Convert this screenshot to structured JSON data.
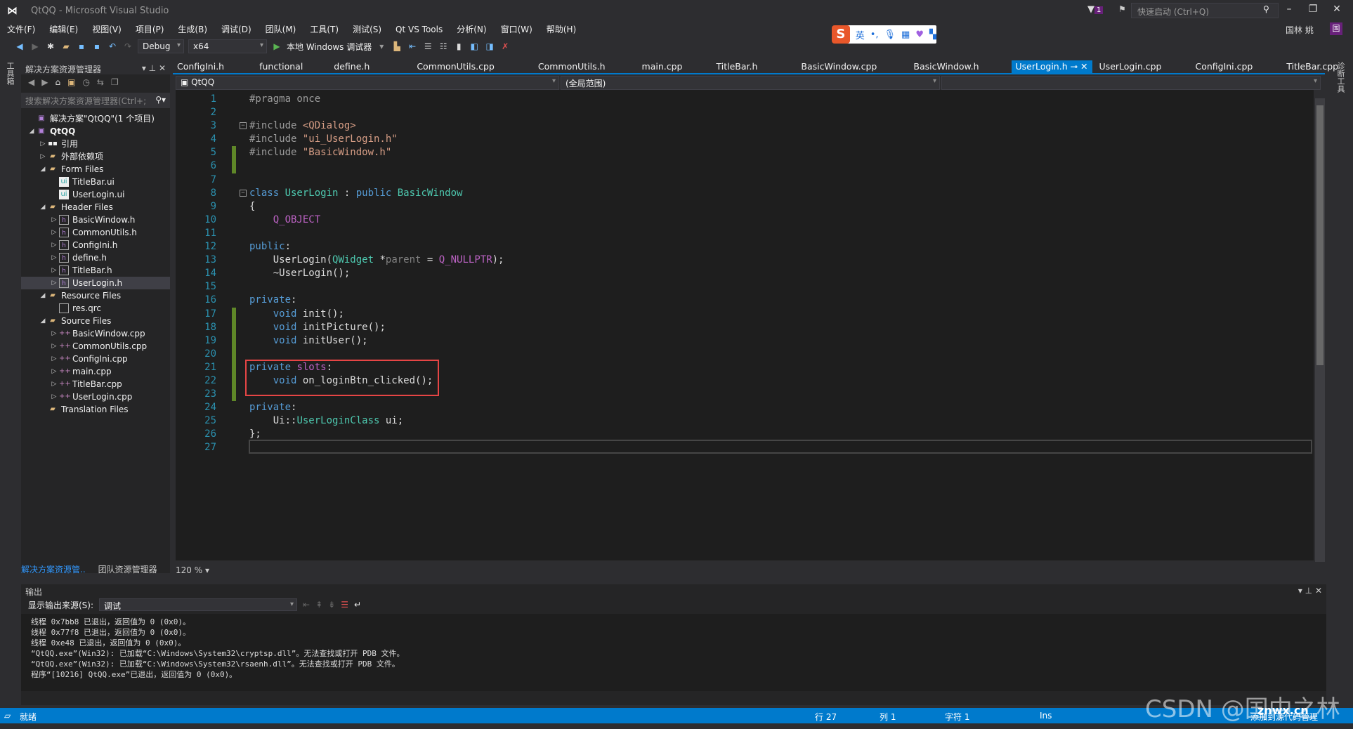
{
  "window": {
    "title": "QtQQ - Microsoft Visual Studio",
    "quick_launch_placeholder": "快速启动 (Ctrl+Q)",
    "notification_count": "1",
    "user": "国林 姚",
    "user_badge": "国"
  },
  "menu": [
    "文件(F)",
    "编辑(E)",
    "视图(V)",
    "项目(P)",
    "生成(B)",
    "调试(D)",
    "团队(M)",
    "工具(T)",
    "测试(S)",
    "Qt VS Tools",
    "分析(N)",
    "窗口(W)",
    "帮助(H)"
  ],
  "toolbar": {
    "config": "Debug",
    "platform": "x64",
    "run_label": "本地 Windows 调试器"
  },
  "ime": {
    "lang": "英"
  },
  "left_strip": "工具箱",
  "right_strip": "诊断工具",
  "solution_explorer": {
    "title": "解决方案资源管理器",
    "search_placeholder": "搜索解决方案资源管理器(Ctrl+;",
    "tree": [
      {
        "label": "解决方案\"QtQQ\"(1 个项目)",
        "level": 0,
        "arrow": "",
        "icon": "proj"
      },
      {
        "label": "QtQQ",
        "level": 0,
        "arrow": "◢",
        "icon": "proj"
      },
      {
        "label": "引用",
        "level": 1,
        "arrow": "▷",
        "icon": "ref"
      },
      {
        "label": "外部依赖项",
        "level": 1,
        "arrow": "▷",
        "icon": "folder"
      },
      {
        "label": "Form Files",
        "level": 1,
        "arrow": "◢",
        "icon": "folder"
      },
      {
        "label": "TitleBar.ui",
        "level": 2,
        "arrow": "",
        "icon": "ui"
      },
      {
        "label": "UserLogin.ui",
        "level": 2,
        "arrow": "",
        "icon": "ui"
      },
      {
        "label": "Header Files",
        "level": 1,
        "arrow": "◢",
        "icon": "folder"
      },
      {
        "label": "BasicWindow.h",
        "level": 2,
        "arrow": "▷",
        "icon": "h"
      },
      {
        "label": "CommonUtils.h",
        "level": 2,
        "arrow": "▷",
        "icon": "h"
      },
      {
        "label": "ConfigIni.h",
        "level": 2,
        "arrow": "▷",
        "icon": "h"
      },
      {
        "label": "define.h",
        "level": 2,
        "arrow": "▷",
        "icon": "h"
      },
      {
        "label": "TitleBar.h",
        "level": 2,
        "arrow": "▷",
        "icon": "h"
      },
      {
        "label": "UserLogin.h",
        "level": 2,
        "arrow": "▷",
        "icon": "h",
        "selected": true
      },
      {
        "label": "Resource Files",
        "level": 1,
        "arrow": "◢",
        "icon": "folder"
      },
      {
        "label": "res.qrc",
        "level": 2,
        "arrow": "",
        "icon": "file"
      },
      {
        "label": "Source Files",
        "level": 1,
        "arrow": "◢",
        "icon": "folder"
      },
      {
        "label": "BasicWindow.cpp",
        "level": 2,
        "arrow": "▷",
        "icon": "cpp"
      },
      {
        "label": "CommonUtils.cpp",
        "level": 2,
        "arrow": "▷",
        "icon": "cpp"
      },
      {
        "label": "ConfigIni.cpp",
        "level": 2,
        "arrow": "▷",
        "icon": "cpp"
      },
      {
        "label": "main.cpp",
        "level": 2,
        "arrow": "▷",
        "icon": "cpp"
      },
      {
        "label": "TitleBar.cpp",
        "level": 2,
        "arrow": "▷",
        "icon": "cpp"
      },
      {
        "label": "UserLogin.cpp",
        "level": 2,
        "arrow": "▷",
        "icon": "cpp"
      },
      {
        "label": "Translation Files",
        "level": 1,
        "arrow": "",
        "icon": "folder"
      }
    ],
    "bottom_tabs": [
      "解决方案资源管..",
      "团队资源管理器"
    ]
  },
  "editor": {
    "tabs": [
      "ConfigIni.h",
      "functional",
      "define.h",
      "CommonUtils.cpp",
      "CommonUtils.h",
      "main.cpp",
      "TitleBar.h",
      "BasicWindow.cpp",
      "BasicWindow.h",
      "UserLogin.h",
      "UserLogin.cpp",
      "ConfigIni.cpp",
      "TitleBar.cpp"
    ],
    "active_tab": "UserLogin.h",
    "nav_project": "QtQQ",
    "nav_scope": "(全局范围)",
    "zoom": "120 %",
    "changed_lines": [
      5,
      6,
      17,
      18,
      19,
      20,
      21,
      22,
      23
    ],
    "fold_lines": [
      3,
      8
    ],
    "highlighted_lines": [
      21,
      22,
      23
    ],
    "highlight_color": "#e64545",
    "lines": [
      [
        [
          "#pragma once",
          "p"
        ]
      ],
      [],
      [
        [
          "#include ",
          "p"
        ],
        [
          "<QDialog>",
          "s"
        ]
      ],
      [
        [
          "#include ",
          "p"
        ],
        [
          "\"ui_UserLogin.h\"",
          "s"
        ]
      ],
      [
        [
          "#include ",
          "p"
        ],
        [
          "\"BasicWindow.h\"",
          "s"
        ]
      ],
      [],
      [],
      [
        [
          "class ",
          "k"
        ],
        [
          "UserLogin",
          "t"
        ],
        [
          " : ",
          "d"
        ],
        [
          "public ",
          "k"
        ],
        [
          "BasicWindow",
          "t"
        ]
      ],
      [
        [
          "{",
          "d"
        ]
      ],
      [
        [
          "    ",
          "d"
        ],
        [
          "Q_OBJECT",
          "m"
        ]
      ],
      [],
      [
        [
          "public",
          "k"
        ],
        [
          ":",
          "d"
        ]
      ],
      [
        [
          "    UserLogin(",
          "d"
        ],
        [
          "QWidget",
          "t"
        ],
        [
          " *",
          "d"
        ],
        [
          "parent",
          "g"
        ],
        [
          " = ",
          "d"
        ],
        [
          "Q_NULLPTR",
          "m"
        ],
        [
          ");",
          "d"
        ]
      ],
      [
        [
          "    ~UserLogin();",
          "d"
        ]
      ],
      [],
      [
        [
          "private",
          "k"
        ],
        [
          ":",
          "d"
        ]
      ],
      [
        [
          "    ",
          "d"
        ],
        [
          "void ",
          "k"
        ],
        [
          "init();",
          "d"
        ]
      ],
      [
        [
          "    ",
          "d"
        ],
        [
          "void ",
          "k"
        ],
        [
          "initPicture();",
          "d"
        ]
      ],
      [
        [
          "    ",
          "d"
        ],
        [
          "void ",
          "k"
        ],
        [
          "initUser();",
          "d"
        ]
      ],
      [],
      [
        [
          "private ",
          "k"
        ],
        [
          "slots",
          "m"
        ],
        [
          ":",
          "d"
        ]
      ],
      [
        [
          "    ",
          "d"
        ],
        [
          "void ",
          "k"
        ],
        [
          "on_loginBtn_clicked();",
          "d"
        ]
      ],
      [],
      [
        [
          "private",
          "k"
        ],
        [
          ":",
          "d"
        ]
      ],
      [
        [
          "    Ui::",
          "d"
        ],
        [
          "UserLoginClass",
          "t"
        ],
        [
          " ui;",
          "d"
        ]
      ],
      [
        [
          "};",
          "d"
        ]
      ],
      []
    ]
  },
  "output": {
    "title": "输出",
    "source_label": "显示输出来源(S):",
    "source_value": "调试",
    "lines": [
      "线程 0x7bb8 已退出，返回值为 0 (0x0)。",
      "线程 0x77f8 已退出，返回值为 0 (0x0)。",
      "线程 0xe48 已退出，返回值为 0 (0x0)。",
      "“QtQQ.exe”(Win32): 已加载“C:\\Windows\\System32\\cryptsp.dll”。无法查找或打开 PDB 文件。",
      "“QtQQ.exe”(Win32): 已加载“C:\\Windows\\System32\\rsaenh.dll”。无法查找或打开 PDB 文件。",
      "程序“[10216] QtQQ.exe”已退出，返回值为 0 (0x0)。"
    ]
  },
  "status": {
    "ready": "就绪",
    "line": "行 27",
    "col": "列 1",
    "char": "字符 1",
    "mode": "Ins",
    "source_control": "添加到源代码管理"
  },
  "watermark": {
    "csdn": "CSDN @国中之林",
    "site": "znwx.cn"
  }
}
